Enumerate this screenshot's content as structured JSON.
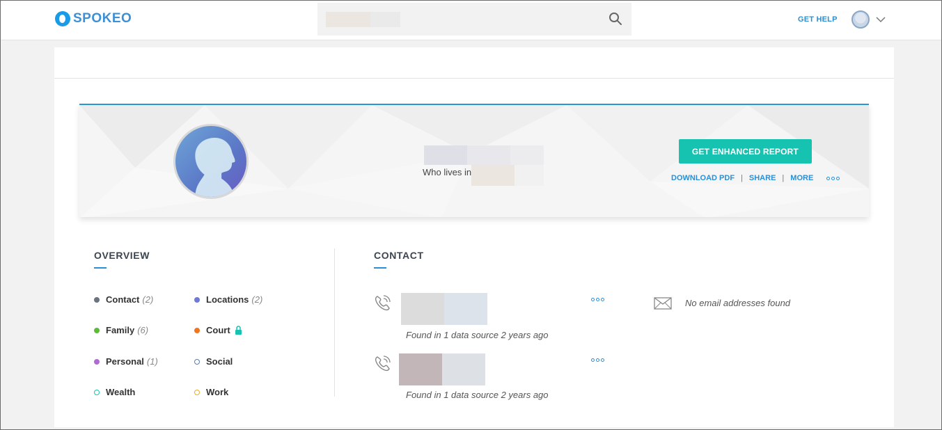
{
  "header": {
    "logo_text": "SPOKEO",
    "get_help": "GET HELP"
  },
  "hero": {
    "who_lives_in": "Who lives in",
    "enhanced_button": "GET ENHANCED REPORT",
    "download_pdf": "DOWNLOAD PDF",
    "separator": "|",
    "share": "SHARE",
    "more": "MORE"
  },
  "overview": {
    "title": "OVERVIEW",
    "items": [
      {
        "label": "Contact",
        "count": "(2)",
        "color": "#6b7280",
        "hollow": false
      },
      {
        "label": "Locations",
        "count": "(2)",
        "color": "#6f79d6",
        "hollow": false
      },
      {
        "label": "Family",
        "count": "(6)",
        "color": "#5fba3c",
        "hollow": false
      },
      {
        "label": "Court",
        "count": "",
        "color": "#f07520",
        "hollow": false,
        "locked": true
      },
      {
        "label": "Personal",
        "count": "(1)",
        "color": "#b06ad0",
        "hollow": false
      },
      {
        "label": "Social",
        "count": "",
        "color": "#5b7fa8",
        "hollow": true
      },
      {
        "label": "Wealth",
        "count": "",
        "color": "#16c3b1",
        "hollow": true
      },
      {
        "label": "Work",
        "count": "",
        "color": "#e8b02a",
        "hollow": true
      }
    ]
  },
  "contact": {
    "title": "CONTACT",
    "phones": [
      {
        "found_text": "Found in 1 data source 2 years ago"
      },
      {
        "found_text": "Found in 1 data source 2 years ago"
      }
    ],
    "no_email": "No email addresses found"
  },
  "colors": {
    "accent": "#2a8fd4",
    "button": "#16c3b1"
  },
  "icons": [
    "logo-mark",
    "search-icon",
    "user-avatar-icon",
    "chevron-down-icon",
    "person-silhouette-icon",
    "more-dots-icon",
    "lock-icon",
    "phone-icon",
    "mail-icon"
  ]
}
